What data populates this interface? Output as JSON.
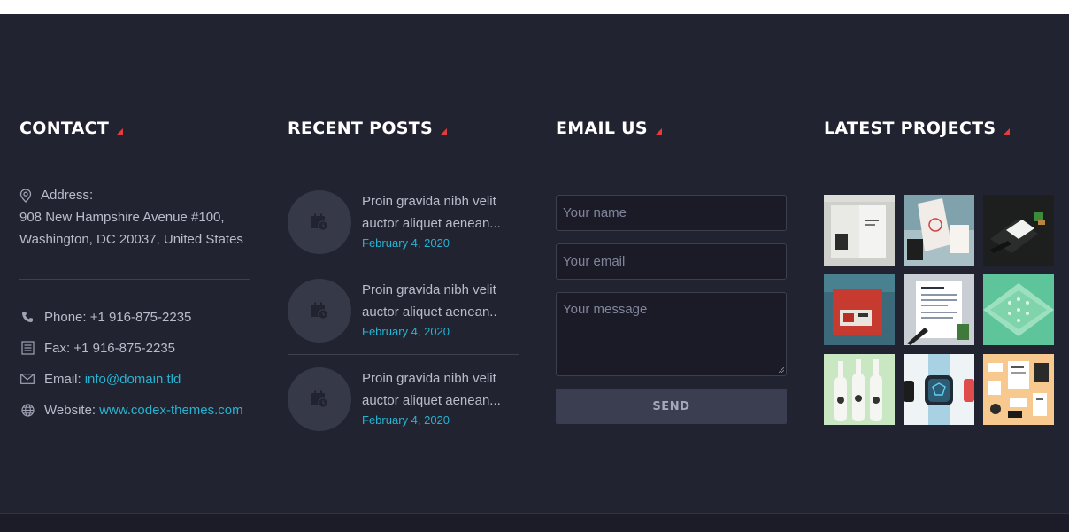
{
  "contact": {
    "heading": "CONTACT",
    "address_label": "Address:",
    "address_line1": "908 New Hampshire Avenue #100,",
    "address_line2": "Washington, DC 20037, United States",
    "phone": "Phone: +1 916-875-2235",
    "fax": "Fax: +1 916-875-2235",
    "email_label": "Email:",
    "email_value": "info@domain.tld",
    "website_label": "Website:",
    "website_value": "www.codex-themes.com",
    "icons": [
      "location-pin-icon",
      "phone-icon",
      "fax-icon",
      "envelope-icon",
      "globe-icon"
    ]
  },
  "posts": {
    "heading": "RECENT POSTS",
    "items": [
      {
        "line1": "Proin gravida nibh velit",
        "line2": "auctor aliquet aenean...",
        "date": "February 4, 2020"
      },
      {
        "line1": "Proin gravida nibh velit",
        "line2": "auctor aliquet aenean..",
        "date": "February 4, 2020"
      },
      {
        "line1": "Proin gravida nibh velit",
        "line2": "auctor aliquet aenean...",
        "date": "February 4, 2020"
      }
    ]
  },
  "email": {
    "heading": "EMAIL US",
    "name_placeholder": "Your name",
    "email_placeholder": "Your email",
    "message_placeholder": "Your message",
    "send_label": "SEND"
  },
  "projects": {
    "heading": "LATEST PROJECTS",
    "items": [
      "project-thumbnail-1",
      "project-thumbnail-2",
      "project-thumbnail-3",
      "project-thumbnail-4",
      "project-thumbnail-5",
      "project-thumbnail-6",
      "project-thumbnail-7",
      "project-thumbnail-8",
      "project-thumbnail-9"
    ]
  },
  "colors": {
    "background": "#222330",
    "accent_link": "#25b3d0",
    "heading_mark": "#e23c3c",
    "input_bg": "#1a1b27",
    "button_bg": "#3a3e50"
  }
}
